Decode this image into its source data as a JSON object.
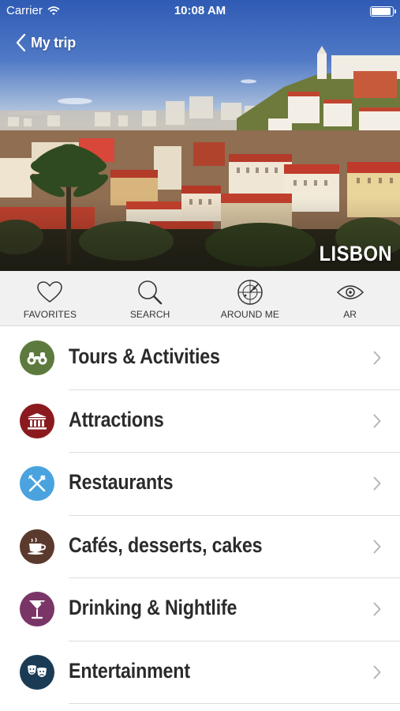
{
  "status_bar": {
    "carrier": "Carrier",
    "time": "10:08 AM"
  },
  "header": {
    "back_label": "My trip",
    "city": "LISBON"
  },
  "toolbar": {
    "items": [
      {
        "label": "FAVORITES",
        "icon": "heart-icon"
      },
      {
        "label": "SEARCH",
        "icon": "magnifier-icon"
      },
      {
        "label": "AROUND ME",
        "icon": "radar-icon"
      },
      {
        "label": "AR",
        "icon": "eye-icon"
      }
    ]
  },
  "categories": [
    {
      "label": "Tours & Activities",
      "icon": "binoculars-icon",
      "color": "#5d7a3e"
    },
    {
      "label": "Attractions",
      "icon": "landmark-icon",
      "color": "#8a1a1e"
    },
    {
      "label": "Restaurants",
      "icon": "fork-knife-icon",
      "color": "#4aa3df"
    },
    {
      "label": "Cafés, desserts, cakes",
      "icon": "coffee-cup-icon",
      "color": "#5b3a2e"
    },
    {
      "label": "Drinking & Nightlife",
      "icon": "cocktail-icon",
      "color": "#7a3567"
    },
    {
      "label": "Entertainment",
      "icon": "theater-masks-icon",
      "color": "#1b3b55"
    }
  ],
  "colors": {
    "toolbar_bg": "#f1f1f1",
    "text": "#2b2b2b",
    "chevron": "#b5b5b5"
  }
}
